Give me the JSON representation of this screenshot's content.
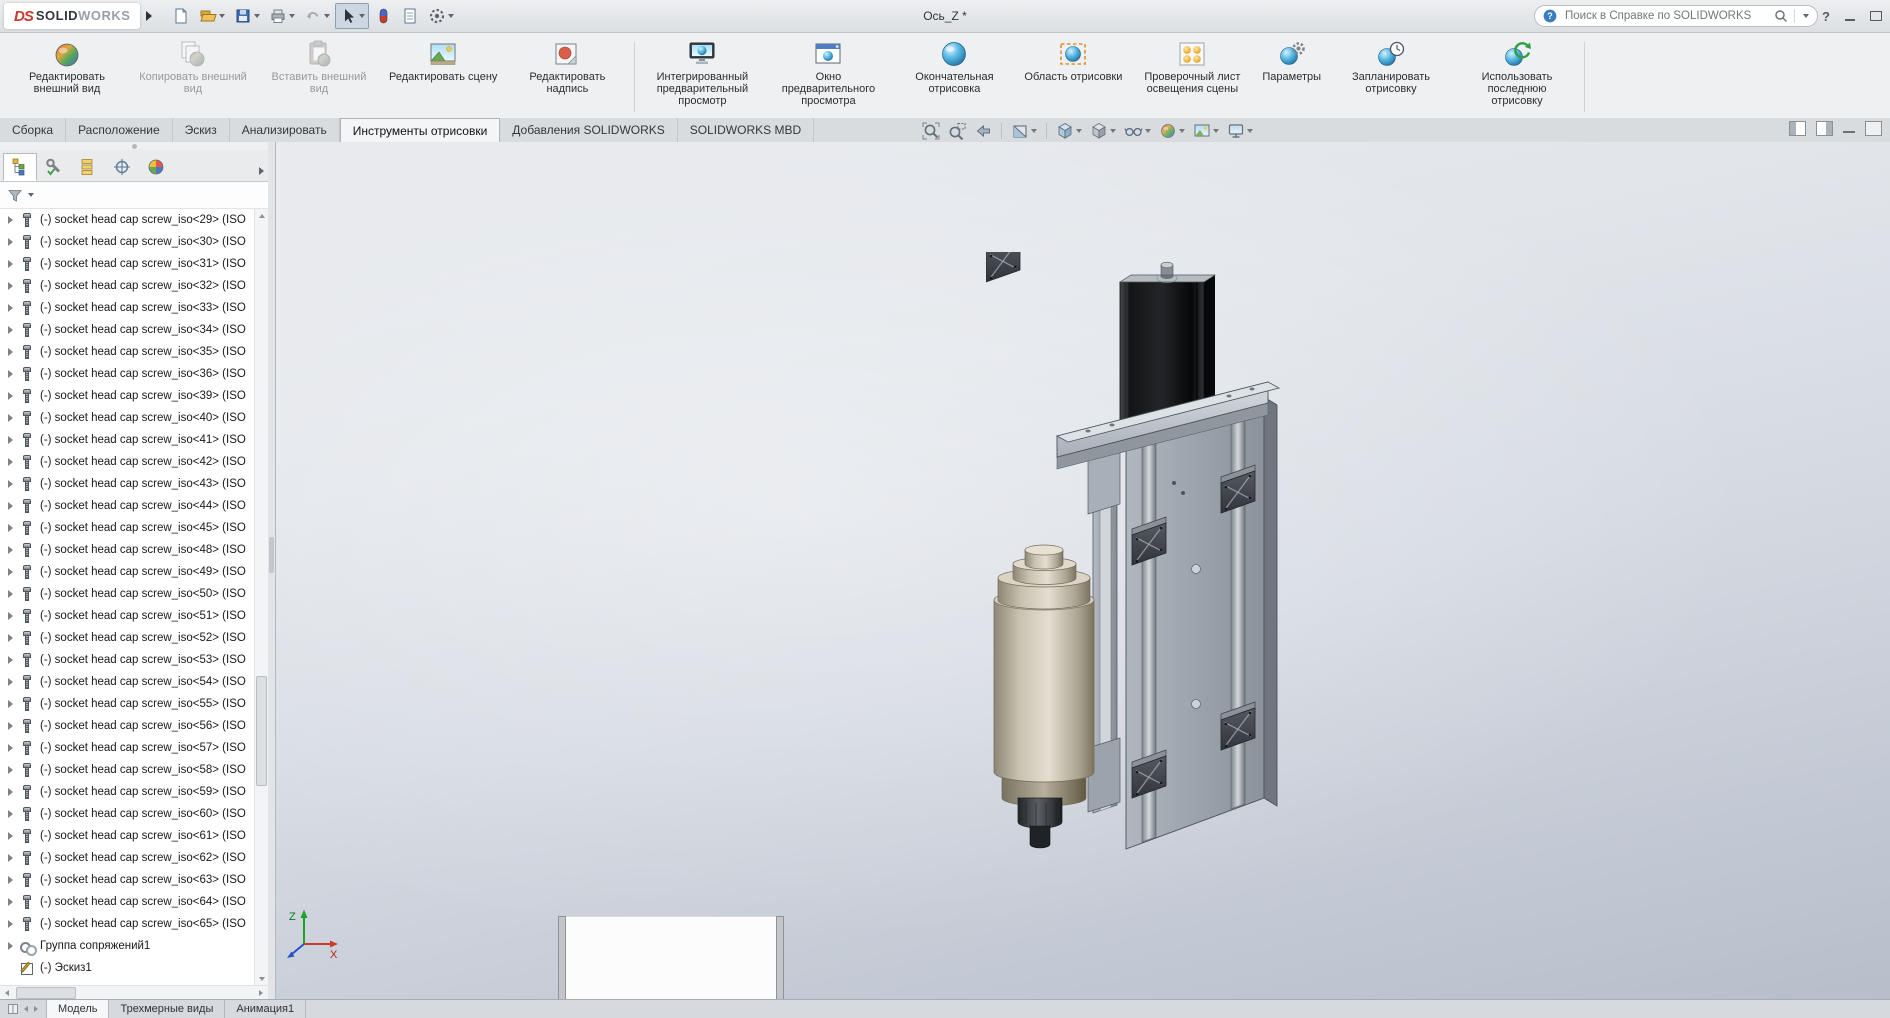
{
  "titlebar": {
    "brand": {
      "ds": "DS",
      "solid": "SOLID",
      "works": "WORKS"
    },
    "document_title": "Ось_Z *",
    "search_placeholder": "Поиск в Справке по SOLIDWORKS",
    "quick_tools": [
      "new-document-icon",
      "open-icon",
      "save-icon",
      "print-icon",
      "undo-icon",
      "select-arrow-icon",
      "rebuild-icon",
      "file-properties-icon",
      "options-gear-icon"
    ],
    "window_controls": [
      "help-icon",
      "minimize-icon",
      "maximize-icon"
    ]
  },
  "ribbon": {
    "buttons": [
      {
        "label": "Редактировать внешний вид",
        "enabled": true,
        "icon": "edit-appearance-icon"
      },
      {
        "label": "Копировать внешний вид",
        "enabled": false,
        "icon": "copy-appearance-icon"
      },
      {
        "label": "Вставить внешний вид",
        "enabled": false,
        "icon": "paste-appearance-icon"
      },
      {
        "label": "Редактировать сцену",
        "enabled": true,
        "icon": "edit-scene-icon"
      },
      {
        "label": "Редактировать надпись",
        "enabled": true,
        "icon": "edit-decal-icon"
      },
      {
        "label": "Интегрированный предварительный просмотр",
        "enabled": true,
        "icon": "integrated-preview-icon"
      },
      {
        "label": "Окно предварительного просмотра",
        "enabled": true,
        "icon": "preview-window-icon"
      },
      {
        "label": "Окончательная отрисовка",
        "enabled": true,
        "icon": "final-render-icon"
      },
      {
        "label": "Область отрисовки",
        "enabled": true,
        "icon": "render-region-icon"
      },
      {
        "label": "Проверочный лист освещения сцены",
        "enabled": true,
        "icon": "proof-sheet-icon"
      },
      {
        "label": "Параметры",
        "enabled": true,
        "icon": "render-options-icon"
      },
      {
        "label": "Запланировать отрисовку",
        "enabled": true,
        "icon": "schedule-render-icon"
      },
      {
        "label": "Использовать последнюю отрисовку",
        "enabled": true,
        "icon": "recall-render-icon"
      }
    ]
  },
  "command_tabs": [
    {
      "label": "Сборка",
      "active": false
    },
    {
      "label": "Расположение",
      "active": false
    },
    {
      "label": "Эскиз",
      "active": false
    },
    {
      "label": "Анализировать",
      "active": false
    },
    {
      "label": "Инструменты отрисовки",
      "active": true
    },
    {
      "label": "Добавления SOLIDWORKS",
      "active": false
    },
    {
      "label": "SOLIDWORKS MBD",
      "active": false
    }
  ],
  "headsup_tools": [
    "zoom-fit-icon",
    "zoom-area-icon",
    "previous-view-icon",
    "section-view-icon",
    "view-orientation-icon",
    "display-style-icon",
    "hide-show-items-icon",
    "edit-appearance-icon",
    "apply-scene-icon",
    "view-settings-icon"
  ],
  "left_panel": {
    "tabs": [
      "feature-manager-tab",
      "property-manager-tab",
      "configuration-manager-tab",
      "dimxpert-manager-tab",
      "display-manager-tab"
    ],
    "filter_icon": "filter-funnel-icon"
  },
  "feature_tree": {
    "items": [
      {
        "label": "(-) socket head cap screw_iso<29> (ISO",
        "icon": "screw-icon",
        "expand": true
      },
      {
        "label": "(-) socket head cap screw_iso<30> (ISO",
        "icon": "screw-icon",
        "expand": true
      },
      {
        "label": "(-) socket head cap screw_iso<31> (ISO",
        "icon": "screw-icon",
        "expand": true
      },
      {
        "label": "(-) socket head cap screw_iso<32> (ISO",
        "icon": "screw-icon",
        "expand": true
      },
      {
        "label": "(-) socket head cap screw_iso<33> (ISO",
        "icon": "screw-icon",
        "expand": true
      },
      {
        "label": "(-) socket head cap screw_iso<34> (ISO",
        "icon": "screw-icon",
        "expand": true
      },
      {
        "label": "(-) socket head cap screw_iso<35> (ISO",
        "icon": "screw-icon",
        "expand": true
      },
      {
        "label": "(-) socket head cap screw_iso<36> (ISO",
        "icon": "screw-icon",
        "expand": true
      },
      {
        "label": "(-) socket head cap screw_iso<39> (ISO",
        "icon": "screw-icon",
        "expand": true
      },
      {
        "label": "(-) socket head cap screw_iso<40> (ISO",
        "icon": "screw-icon",
        "expand": true
      },
      {
        "label": "(-) socket head cap screw_iso<41> (ISO",
        "icon": "screw-icon",
        "expand": true
      },
      {
        "label": "(-) socket head cap screw_iso<42> (ISO",
        "icon": "screw-icon",
        "expand": true
      },
      {
        "label": "(-) socket head cap screw_iso<43> (ISO",
        "icon": "screw-icon",
        "expand": true
      },
      {
        "label": "(-) socket head cap screw_iso<44> (ISO",
        "icon": "screw-icon",
        "expand": true
      },
      {
        "label": "(-) socket head cap screw_iso<45> (ISO",
        "icon": "screw-icon",
        "expand": true
      },
      {
        "label": "(-) socket head cap screw_iso<48> (ISO",
        "icon": "screw-icon",
        "expand": true
      },
      {
        "label": "(-) socket head cap screw_iso<49> (ISO",
        "icon": "screw-icon",
        "expand": true
      },
      {
        "label": "(-) socket head cap screw_iso<50> (ISO",
        "icon": "screw-icon",
        "expand": true
      },
      {
        "label": "(-) socket head cap screw_iso<51> (ISO",
        "icon": "screw-icon",
        "expand": true
      },
      {
        "label": "(-) socket head cap screw_iso<52> (ISO",
        "icon": "screw-icon",
        "expand": true
      },
      {
        "label": "(-) socket head cap screw_iso<53> (ISO",
        "icon": "screw-icon",
        "expand": true
      },
      {
        "label": "(-) socket head cap screw_iso<54> (ISO",
        "icon": "screw-icon",
        "expand": true
      },
      {
        "label": "(-) socket head cap screw_iso<55> (ISO",
        "icon": "screw-icon",
        "expand": true
      },
      {
        "label": "(-) socket head cap screw_iso<56> (ISO",
        "icon": "screw-icon",
        "expand": true
      },
      {
        "label": "(-) socket head cap screw_iso<57> (ISO",
        "icon": "screw-icon",
        "expand": true
      },
      {
        "label": "(-) socket head cap screw_iso<58> (ISO",
        "icon": "screw-icon",
        "expand": true
      },
      {
        "label": "(-) socket head cap screw_iso<59> (ISO",
        "icon": "screw-icon",
        "expand": true
      },
      {
        "label": "(-) socket head cap screw_iso<60> (ISO",
        "icon": "screw-icon",
        "expand": true
      },
      {
        "label": "(-) socket head cap screw_iso<61> (ISO",
        "icon": "screw-icon",
        "expand": true
      },
      {
        "label": "(-) socket head cap screw_iso<62> (ISO",
        "icon": "screw-icon",
        "expand": true
      },
      {
        "label": "(-) socket head cap screw_iso<63> (ISO",
        "icon": "screw-icon",
        "expand": true
      },
      {
        "label": "(-) socket head cap screw_iso<64> (ISO",
        "icon": "screw-icon",
        "expand": true
      },
      {
        "label": "(-) socket head cap screw_iso<65> (ISO",
        "icon": "screw-icon",
        "expand": true
      },
      {
        "label": "Группа сопряжений1",
        "icon": "mates-icon",
        "expand": true
      },
      {
        "label": "(-) Эскиз1",
        "icon": "sketch-icon",
        "expand": false
      }
    ]
  },
  "viewport": {
    "triad": {
      "z": "Z",
      "x": "X"
    }
  },
  "sheet_tabs": [
    {
      "label": "Модель",
      "active": true
    },
    {
      "label": "Трехмерные виды",
      "active": false
    },
    {
      "label": "Анимация1",
      "active": false
    }
  ]
}
